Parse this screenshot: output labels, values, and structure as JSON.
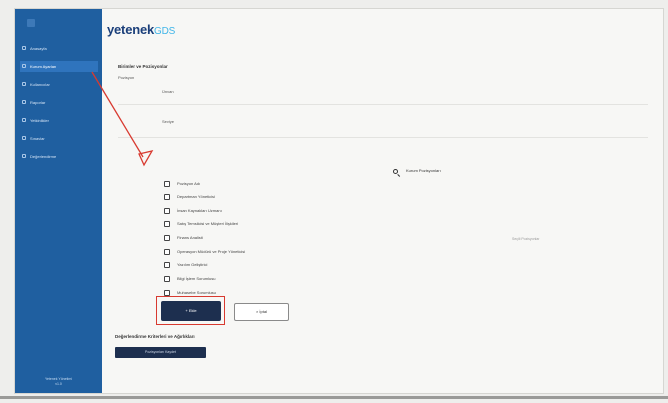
{
  "logo": {
    "name": "yetenek",
    "suffix": "GDS"
  },
  "sidebar": {
    "items": [
      {
        "label": "Anasayfa"
      },
      {
        "label": "Kurum Ayarları"
      },
      {
        "label": "Kullanıcılar"
      },
      {
        "label": "Raporlar"
      },
      {
        "label": "Yetkinlikler"
      },
      {
        "label": "Sınavlar"
      },
      {
        "label": "Değerlendirme"
      }
    ],
    "footer_line1": "Yetenek Yönetimi",
    "footer_line2": "v1.0"
  },
  "form": {
    "section_title": "Birimler ve Pozisyonlar",
    "sub_label": "Pozisyon",
    "field_a": "Ünvan",
    "field_b": "Seviye"
  },
  "search": {
    "label": "Kurum Pozisyonları"
  },
  "checkbox_items": [
    {
      "label": "Pozisyon Adı"
    },
    {
      "label": "Departman Yöneticisi"
    },
    {
      "label": "İnsan Kaynakları Uzmanı"
    },
    {
      "label": "Satış Temsilcisi ve Müşteri İlişkileri"
    },
    {
      "label": "Finans Analisti"
    },
    {
      "label": "Operasyon Müdürü ve Proje Yöneticisi"
    },
    {
      "label": "Yazılım Geliştirici"
    },
    {
      "label": "Bilgi İşlem Sorumlusu"
    },
    {
      "label": "Muhasebe Sorumlusu"
    }
  ],
  "side_note": "Seçili Pozisyonlar",
  "buttons": {
    "primary": "+ Ekle",
    "secondary": "× İptal",
    "bottom": "Pozisyonları Kaydet"
  },
  "bottom_title": "Değerlendirme Kriterleri ve Ağırlıkları",
  "colors": {
    "sidebar_bg": "#1f5fa0",
    "accent_dark": "#1d2f4f",
    "annotation_red": "#d83a30"
  }
}
